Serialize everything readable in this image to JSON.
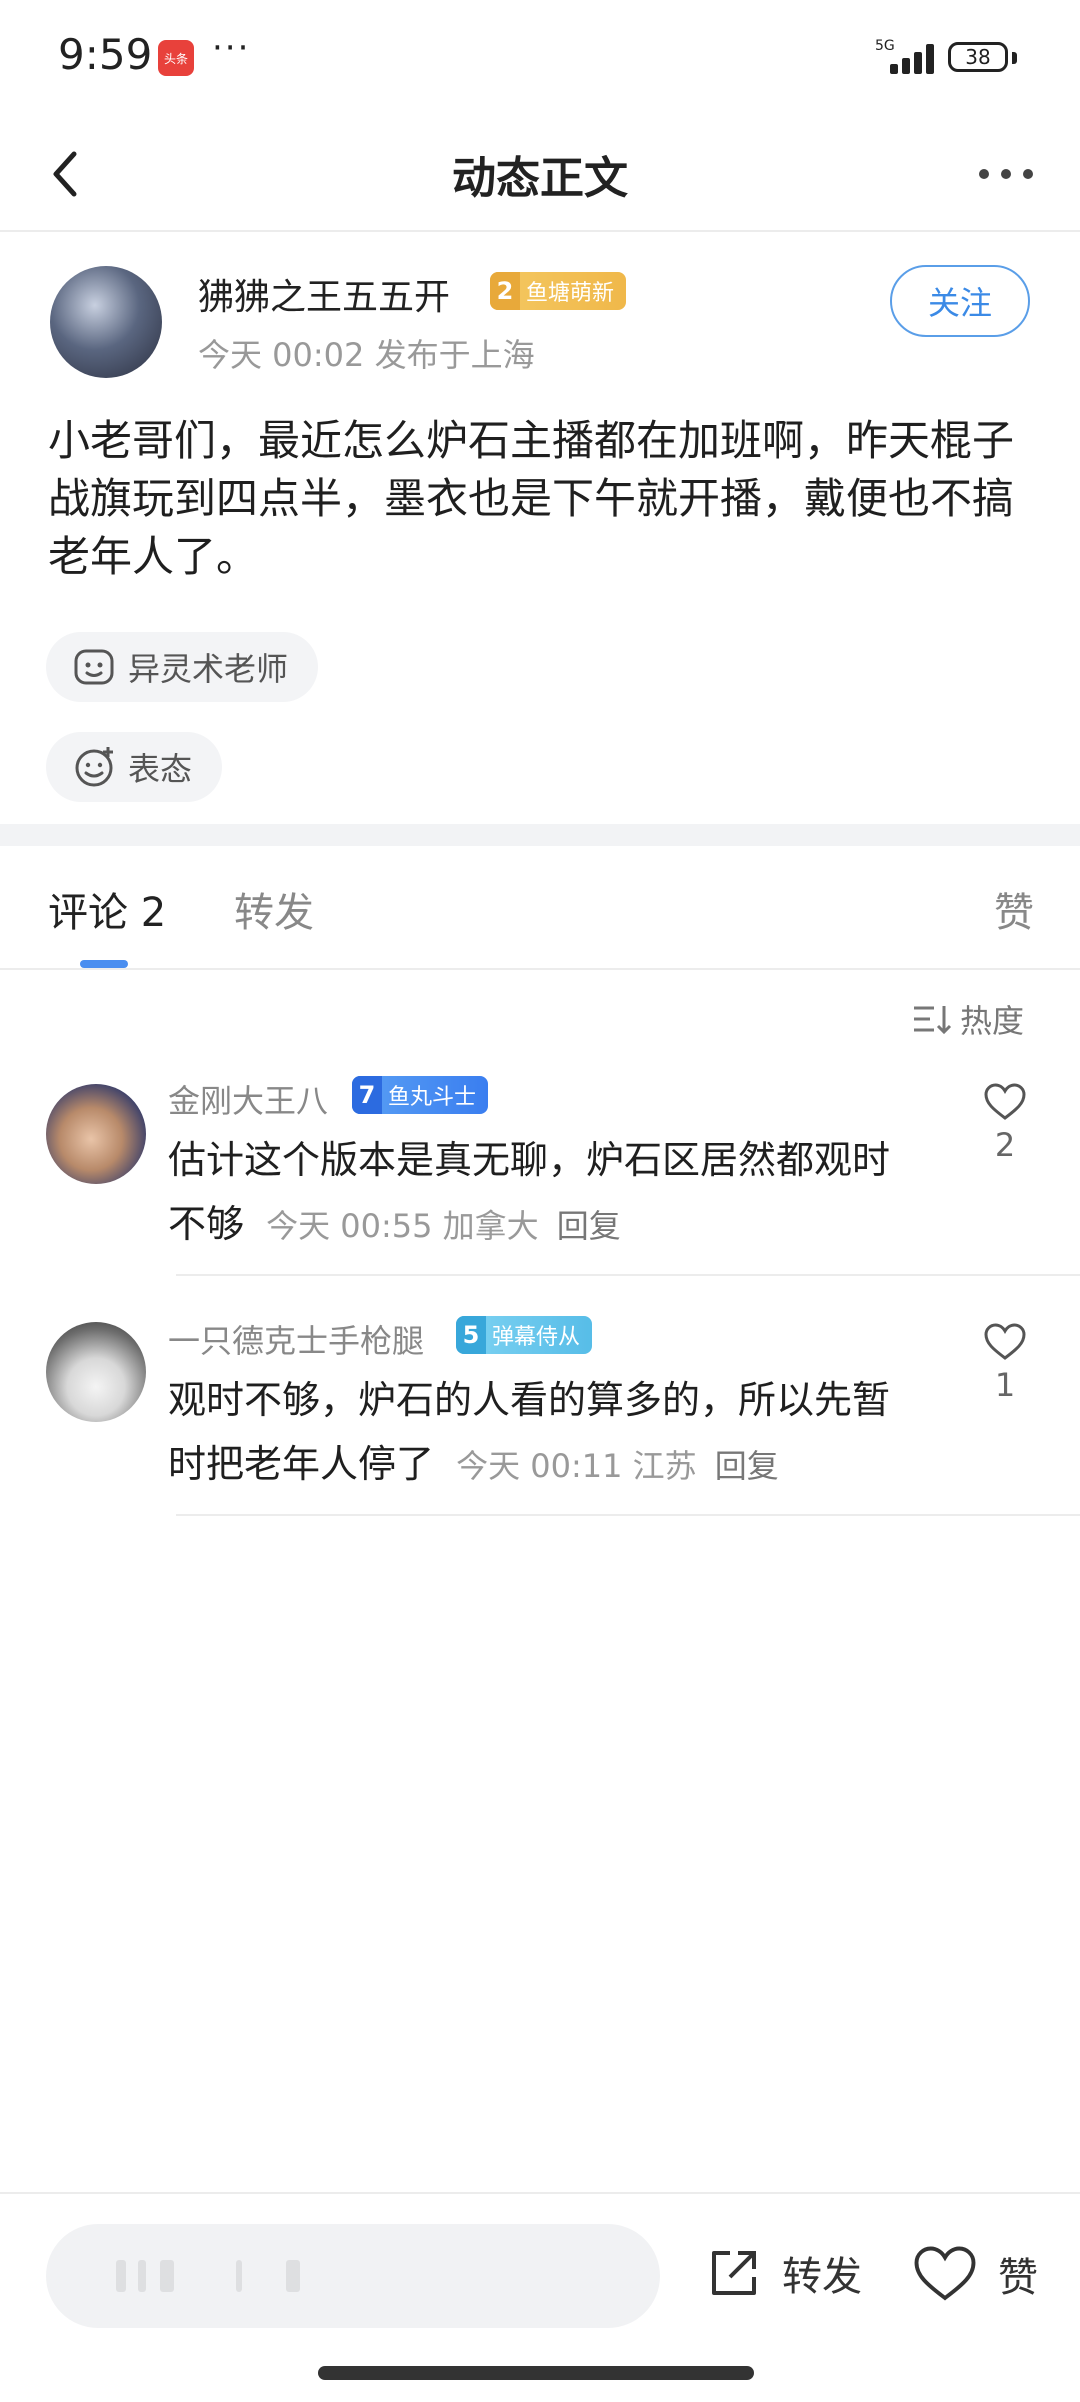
{
  "status_bar": {
    "time": "9:59",
    "news_badge": "头条",
    "more": "···",
    "network": "5G",
    "battery": "38"
  },
  "nav": {
    "title": "动态正文"
  },
  "post": {
    "author": "狒狒之王五五开",
    "badge_level": "2",
    "badge_title": "鱼塘萌新",
    "meta": "今天 00:02 发布于上海",
    "follow_label": "关注",
    "body": "小老哥们，最近怎么炉石主播都在加班啊，昨天棍子战旗玩到四点半，墨衣也是下午就开播，戴便也不搞老年人了。",
    "topic": "异灵术老师",
    "react_label": "表态"
  },
  "tabs": {
    "comments": "评论 2",
    "forward": "转发",
    "likes": "赞"
  },
  "sort": {
    "label": "热度"
  },
  "comments": [
    {
      "user": "金刚大王八",
      "badge_level": "7",
      "badge_title": "鱼丸斗士",
      "text": "估计这个版本是真无聊，炉石区居然都观时不够",
      "meta": "今天 00:55 加拿大",
      "reply": "回复",
      "likes": "2"
    },
    {
      "user": "一只德克士手枪腿",
      "badge_level": "5",
      "badge_title": "弹幕侍从",
      "text": "观时不够，炉石的人看的算多的，所以先暂时把老年人停了",
      "meta": "今天 00:11 江苏",
      "reply": "回复",
      "likes": "1"
    }
  ],
  "bottom_bar": {
    "forward_label": "转发",
    "like_label": "赞"
  },
  "colors": {
    "accent": "#3b8ae6",
    "badge_gold": "#f0b84a",
    "badge_blue": "#3a7ef0",
    "badge_cyan": "#57bde8"
  }
}
